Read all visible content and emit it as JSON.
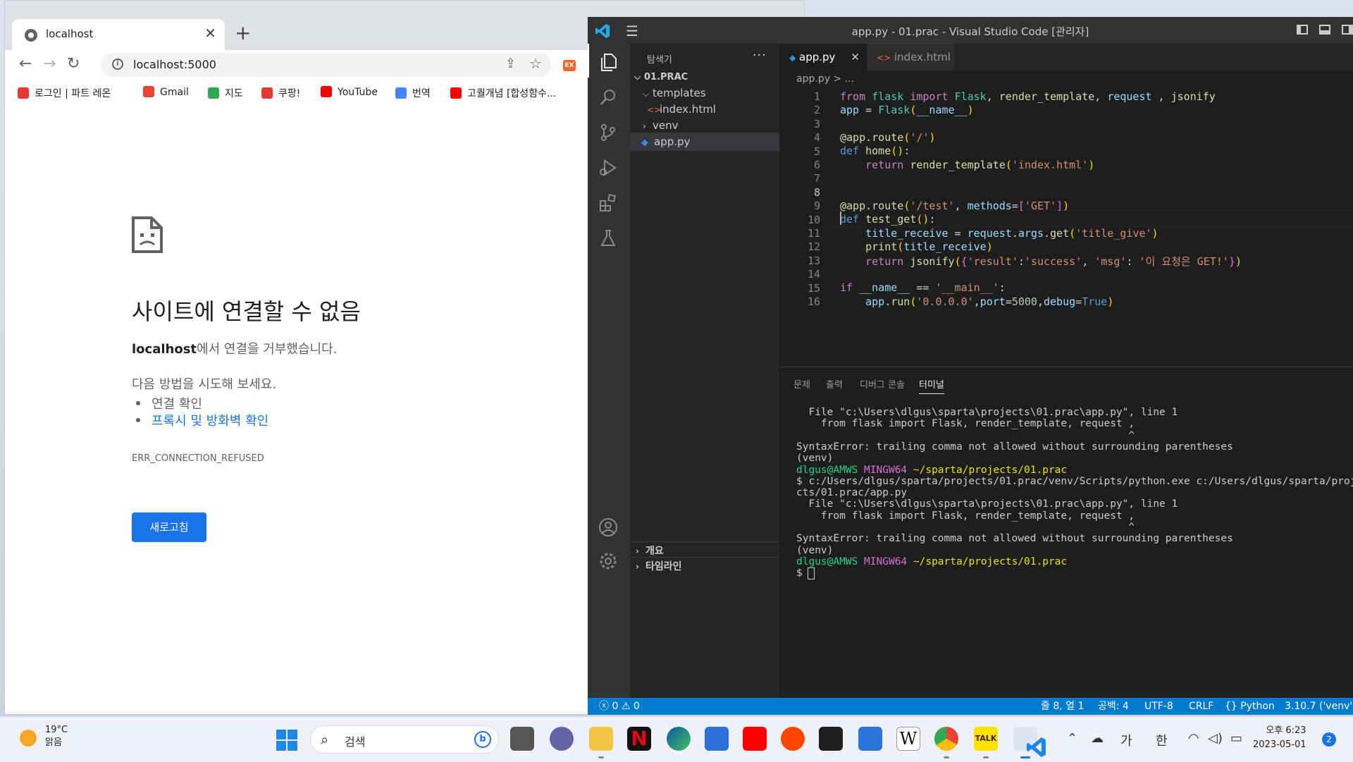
{
  "chrome": {
    "tab_title": "localhost",
    "tab_close": "✕",
    "new_tab": "+",
    "url": "localhost:5000",
    "bookmarks": [
      {
        "label": "로그인 | 파트 레온",
        "color": "#e53935"
      },
      {
        "label": "Gmail",
        "color": "#ea4335"
      },
      {
        "label": "지도",
        "color": "#34a853"
      },
      {
        "label": "쿠팡!",
        "color": "#e53935"
      },
      {
        "label": "YouTube",
        "color": "#ff0000"
      },
      {
        "label": "번역",
        "color": "#4285f4"
      },
      {
        "label": "고퀄개념 [합성함수...",
        "color": "#ff0000"
      }
    ],
    "error": {
      "title": "사이트에 연결할 수 없음",
      "host": "localhost",
      "desc_suffix": "에서 연결을 거부했습니다.",
      "try_title": "다음 방법을 시도해 보세요.",
      "try_items": [
        "연결 확인",
        "프록시 및 방화벽 확인"
      ],
      "code": "ERR_CONNECTION_REFUSED",
      "reload_label": "새로고침"
    }
  },
  "vscode": {
    "window_title": "app.py - 01.prac - Visual Studio Code [관리자]",
    "explorer_title": "탐색기",
    "explorer_more": "···",
    "tree": [
      {
        "label": "01.PRAC",
        "type": "root"
      },
      {
        "label": "templates",
        "type": "folder-open"
      },
      {
        "label": "index.html",
        "type": "html"
      },
      {
        "label": "venv",
        "type": "folder-closed"
      },
      {
        "label": "app.py",
        "type": "py"
      }
    ],
    "outline_label": "개요",
    "timeline_label": "타임라인",
    "tabs": [
      {
        "label": "app.py",
        "active": true
      },
      {
        "label": "index.html",
        "active": false
      }
    ],
    "breadcrumb": "app.py > ...",
    "code_lines": [
      "1",
      "2",
      "3",
      "4",
      "5",
      "6",
      "7",
      "8",
      "9",
      "10",
      "11",
      "12",
      "13",
      "14",
      "15",
      "16"
    ],
    "panel_tabs": [
      "문제",
      "출력",
      "디버그 콘솔",
      "터미널"
    ],
    "status": {
      "errors": "0",
      "warnings": "0",
      "position": "줄 8, 열 1",
      "spaces": "공백: 4",
      "encoding": "UTF-8",
      "eol": "CRLF",
      "language": "Python",
      "interpreter": "3.10.7 ('venv':"
    }
  },
  "code": {
    "l1": [
      "from",
      "flask",
      "import",
      "Flask",
      "render_template",
      "request",
      "jsonify"
    ],
    "l2": [
      "app",
      "Flask",
      "__name__"
    ],
    "l4": [
      "@app.route",
      "'/'"
    ],
    "l5": [
      "def",
      "home"
    ],
    "l6": [
      "return",
      "render_template",
      "'index.html'"
    ],
    "l9": [
      "@app.route",
      "'/test'",
      "methods",
      "'GET'"
    ],
    "l10": [
      "def",
      "test_get"
    ],
    "l11": [
      "title_receive",
      "request",
      "args",
      "get",
      "'title_give'"
    ],
    "l12": [
      "print",
      "title_receive"
    ],
    "l13": [
      "return",
      "jsonify",
      "'result'",
      "'success'",
      "'msg'",
      "'이 요청은 GET!'"
    ],
    "l15": [
      "if",
      "__name__",
      "'__main__'"
    ],
    "l16": [
      "app",
      "run",
      "'0.0.0.0'",
      "port",
      "5000",
      "debug",
      "True"
    ]
  },
  "terminal": {
    "lines": [
      "  File \"c:\\Users\\dlgus\\sparta\\projects\\01.prac\\app.py\", line 1",
      "    from flask import Flask, render_template, request ,",
      "                                                      ^",
      "SyntaxError: trailing comma not allowed without surrounding parentheses",
      "(venv)",
      "PROMPT",
      "$ c:/Users/dlgus/sparta/projects/01.prac/venv/Scripts/python.exe c:/Users/dlgus/sparta/proje",
      "cts/01.prac/app.py",
      "  File \"c:\\Users\\dlgus\\sparta\\projects\\01.prac\\app.py\", line 1",
      "    from flask import Flask, render_template, request ,",
      "                                                      ^",
      "SyntaxError: trailing comma not allowed without surrounding parentheses",
      "(venv)",
      "PROMPT",
      "$ "
    ],
    "prompt_user": "dlgus@AMWS",
    "prompt_sys": "MINGW64",
    "prompt_path": "~/sparta/projects/01.prac"
  },
  "taskbar": {
    "temp": "19°C",
    "weather": "맑음",
    "search_label": "검색",
    "tray_lang1": "가",
    "tray_lang2": "한",
    "time": "오후 6:23",
    "date": "2023-05-01",
    "notifications": "2"
  }
}
